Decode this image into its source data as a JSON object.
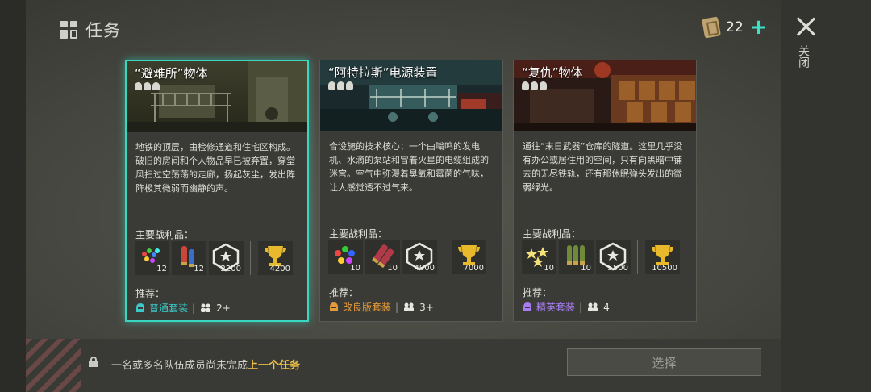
{
  "header": {
    "title": "任务",
    "ticket_count": "22",
    "plus": "+",
    "close_label": "关闭"
  },
  "cards": [
    {
      "title": "“避难所”物体",
      "description": "地铁的顶层，由检修通道和住宅区构成。破旧的房间和个人物品早已被弃置，穿堂风扫过空荡荡的走廊，扬起灰尘，发出阵阵极其微弱而幽静的声。",
      "loot_label": "主要战利品：",
      "loot": [
        "12",
        "12",
        "2200",
        "4200"
      ],
      "rec_label": "推荐：",
      "gear": "普通套装",
      "gear_color": "#39c9c9",
      "squad": "2+"
    },
    {
      "title": "“阿特拉斯”电源装置",
      "description": "合设施的技术核心：一个由嗡鸣的发电机、水滴的泵站和冒着火星的电缆组成的迷宫。空气中弥漫着臭氧和霉菌的气味，让人感觉透不过气来。",
      "loot_label": "主要战利品：",
      "loot": [
        "10",
        "10",
        "4000",
        "7000"
      ],
      "rec_label": "推荐：",
      "gear": "改良版套装",
      "gear_color": "#e59a3a",
      "squad": "3+"
    },
    {
      "title": "“复仇”物体",
      "description": "通往“末日武器”仓库的隧道。这里几乎没有办公或居住用的空间，只有向黑暗中铺去的无尽铁轨，还有那休眠弹头发出的微弱绿光。",
      "loot_label": "主要战利品：",
      "loot": [
        "10",
        "10",
        "5500",
        "10500"
      ],
      "rec_label": "推荐：",
      "gear": "精英套装",
      "gear_color": "#a67cf0",
      "squad": "4"
    }
  ],
  "footer": {
    "lock_msg": "一名或多名队伍成员尚未完成",
    "lock_link": "上一个任务",
    "select_label": "选择"
  },
  "icons": [
    "grid-icon",
    "ticket-icon",
    "close-icon",
    "skull-icon",
    "lock-icon",
    "helmet-icon",
    "persons-icon",
    "trophy-icon",
    "shield-badge-icon"
  ]
}
